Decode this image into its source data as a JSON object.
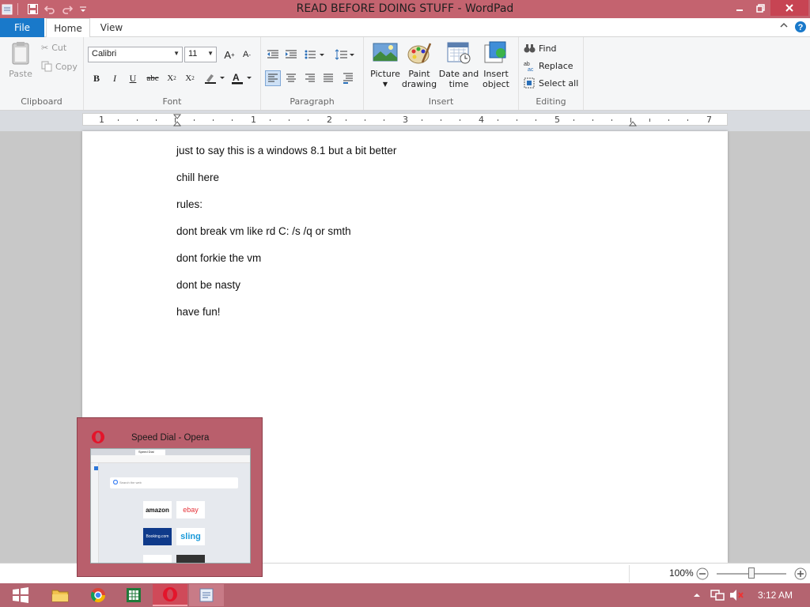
{
  "window": {
    "title": "READ BEFORE DOING STUFF - WordPad"
  },
  "tabs": {
    "file": "File",
    "home": "Home",
    "view": "View"
  },
  "clipboard": {
    "paste": "Paste",
    "cut": "Cut",
    "copy": "Copy",
    "label": "Clipboard"
  },
  "font": {
    "family": "Calibri",
    "size": "11",
    "label": "Font"
  },
  "paragraph": {
    "label": "Paragraph"
  },
  "insert": {
    "picture": "Picture",
    "paint_1": "Paint",
    "paint_2": "drawing",
    "date_1": "Date and",
    "date_2": "time",
    "object_1": "Insert",
    "object_2": "object",
    "label": "Insert"
  },
  "editing": {
    "find": "Find",
    "replace": "Replace",
    "select_all": "Select all",
    "label": "Editing"
  },
  "ruler": {
    "ticks": [
      "1",
      "1",
      "2",
      "3",
      "4",
      "5",
      "7"
    ]
  },
  "document": {
    "lines": [
      "just to say this is a windows 8.1 but a bit better",
      "chill here",
      "rules:",
      "dont break vm like rd C: /s /q or smth",
      "dont forkie the vm",
      "dont be nasty",
      "have fun!"
    ]
  },
  "status": {
    "zoom": "100%"
  },
  "preview": {
    "title": "Speed Dial - Opera",
    "tiles": [
      "amazon",
      "ebay",
      "Booking.com",
      "sling"
    ],
    "tab_label": "Speed Dial",
    "search_placeholder": "Search the web"
  },
  "taskbar": {
    "clock": "3:12 AM"
  },
  "colors": {
    "accent": "#1979ca",
    "titlebar": "#c4636f",
    "taskbar": "#b46470"
  }
}
